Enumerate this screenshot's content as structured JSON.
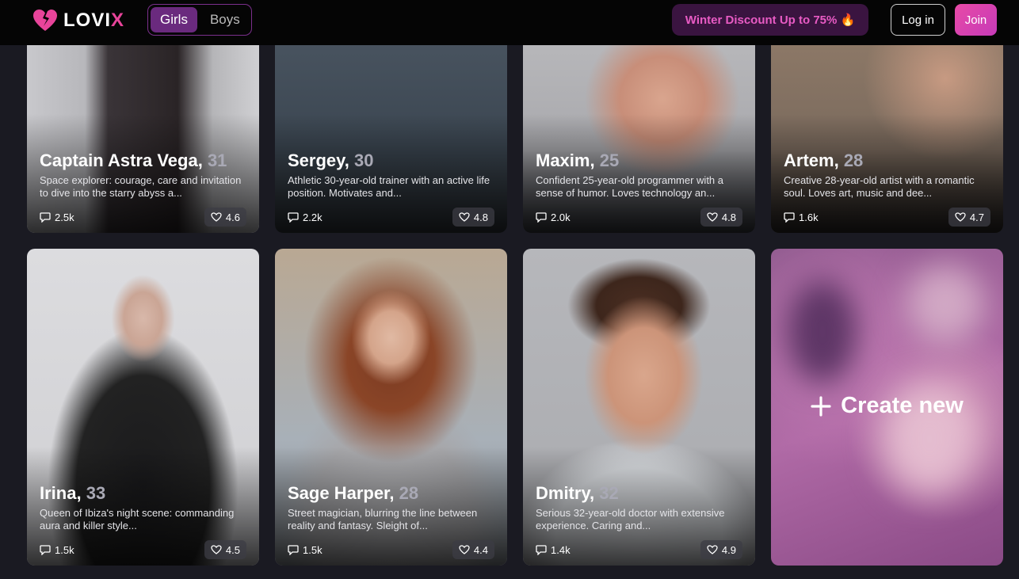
{
  "header": {
    "logo": "LOVI",
    "logo_accent": "X",
    "tabs": [
      {
        "label": "Girls",
        "active": true
      },
      {
        "label": "Boys",
        "active": false
      }
    ],
    "promo": "Winter Discount Up to 75% 🔥",
    "login": "Log in",
    "join": "Join"
  },
  "cards": [
    {
      "name": "Captain Astra Vega,",
      "age": "31",
      "desc": "Space explorer: courage, care and invitation to dive into the starry abyss a...",
      "chats": "2.5k",
      "rating": "4.6"
    },
    {
      "name": "Sergey,",
      "age": "30",
      "desc": "Athletic 30-year-old trainer with an active life position. Motivates and...",
      "chats": "2.2k",
      "rating": "4.8"
    },
    {
      "name": "Maxim,",
      "age": "25",
      "desc": "Confident 25-year-old programmer with a sense of humor. Loves technology an...",
      "chats": "2.0k",
      "rating": "4.8"
    },
    {
      "name": "Artem,",
      "age": "28",
      "desc": "Creative 28-year-old artist with a romantic soul. Loves art, music and dee...",
      "chats": "1.6k",
      "rating": "4.7"
    },
    {
      "name": "Irina,",
      "age": "33",
      "desc": "Queen of Ibiza's night scene: commanding aura and killer style...",
      "chats": "1.5k",
      "rating": "4.5"
    },
    {
      "name": "Sage Harper,",
      "age": "28",
      "desc": "Street magician, blurring the line between reality and fantasy. Sleight of...",
      "chats": "1.5k",
      "rating": "4.4"
    },
    {
      "name": "Dmitry,",
      "age": "32",
      "desc": "Serious 32-year-old doctor with extensive experience. Caring and...",
      "chats": "1.4k",
      "rating": "4.9"
    }
  ],
  "create": {
    "label": "Create new"
  }
}
